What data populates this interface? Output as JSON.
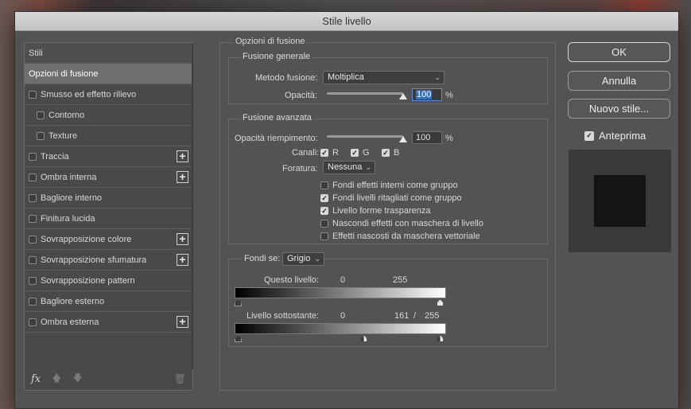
{
  "window": {
    "title": "Stile livello"
  },
  "styles_list": {
    "header": "Stili",
    "items": [
      {
        "label": "Opzioni di fusione",
        "selected": true,
        "checkbox": false,
        "plus": false,
        "indent": false
      },
      {
        "label": "Smusso ed effetto rilievo",
        "checkbox": true,
        "plus": false,
        "indent": false
      },
      {
        "label": "Contorno",
        "checkbox": true,
        "plus": false,
        "indent": true
      },
      {
        "label": "Texture",
        "checkbox": true,
        "plus": false,
        "indent": true
      },
      {
        "label": "Traccia",
        "checkbox": true,
        "plus": true,
        "indent": false
      },
      {
        "label": "Ombra interna",
        "checkbox": true,
        "plus": true,
        "indent": false
      },
      {
        "label": "Bagliore interno",
        "checkbox": true,
        "plus": false,
        "indent": false
      },
      {
        "label": "Finitura lucida",
        "checkbox": true,
        "plus": false,
        "indent": false
      },
      {
        "label": "Sovrapposizione colore",
        "checkbox": true,
        "plus": true,
        "indent": false
      },
      {
        "label": "Sovrapposizione sfumatura",
        "checkbox": true,
        "plus": true,
        "indent": false
      },
      {
        "label": "Sovrapposizione pattern",
        "checkbox": true,
        "plus": false,
        "indent": false
      },
      {
        "label": "Bagliore esterno",
        "checkbox": true,
        "plus": false,
        "indent": false
      },
      {
        "label": "Ombra esterna",
        "checkbox": true,
        "plus": true,
        "indent": false
      }
    ],
    "footer": {
      "fx_label": "fx",
      "fx_icon": "fx-icon",
      "up_icon": "arrow-up-icon",
      "down_icon": "arrow-down-icon",
      "trash_icon": "trash-icon"
    },
    "plus_symbol": "+"
  },
  "options": {
    "title": "Opzioni di fusione",
    "general": {
      "title": "Fusione generale",
      "blend_mode_label": "Metodo fusione:",
      "blend_mode_value": "Moltiplica",
      "opacity_label": "Opacità:",
      "opacity_value": "100",
      "opacity_unit": "%",
      "opacity_fraction": 1.0
    },
    "advanced": {
      "title": "Fusione avanzata",
      "fill_opacity_label": "Opacità riempimento:",
      "fill_opacity_value": "100",
      "fill_opacity_unit": "%",
      "fill_opacity_fraction": 1.0,
      "channels_label": "Canali:",
      "channels": [
        {
          "label": "R",
          "checked": true
        },
        {
          "label": "G",
          "checked": true
        },
        {
          "label": "B",
          "checked": true
        }
      ],
      "knockout_label": "Foratura:",
      "knockout_value": "Nessuna",
      "checkboxes": [
        {
          "label": "Fondi effetti interni come gruppo",
          "checked": false
        },
        {
          "label": "Fondi livelli ritagliati come gruppo",
          "checked": true
        },
        {
          "label": "Livello forme trasparenza",
          "checked": true
        },
        {
          "label": "Nascondi effetti con maschera di livello",
          "checked": false
        },
        {
          "label": "Effetti nascosti da maschera vettoriale",
          "checked": false
        }
      ]
    },
    "blend_if": {
      "label": "Fondi se:",
      "value": "Grigio",
      "this_layer_label": "Questo livello:",
      "this_layer_low": "0",
      "this_layer_high": "255",
      "underlying_label": "Livello sottostante:",
      "underlying_low": "0",
      "underlying_mid": "161",
      "underlying_sep": "/",
      "underlying_high": "255"
    }
  },
  "buttons": {
    "ok": "OK",
    "cancel": "Annulla",
    "new_style": "Nuovo stile..."
  },
  "preview": {
    "label": "Anteprima",
    "checked": true
  },
  "icons": {
    "checkmark": "✓",
    "chevron_down": "⌄"
  },
  "colors": {
    "dialog_bg": "#535353",
    "selection": "#3d6fb8",
    "titlebar": "#c8c8c8"
  }
}
